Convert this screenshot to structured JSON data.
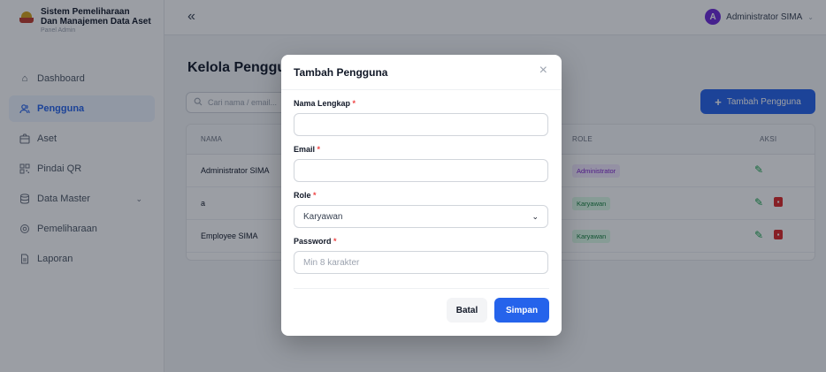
{
  "brand": {
    "title_line1": "Sistem Pemeliharaan",
    "title_line2": "Dan Manajemen Data Aset",
    "subtitle": "Panel Admin"
  },
  "sidebar": {
    "items": [
      {
        "label": "Dashboard",
        "icon": "home-icon"
      },
      {
        "label": "Pengguna",
        "icon": "users-icon",
        "active": true
      },
      {
        "label": "Aset",
        "icon": "box-icon"
      },
      {
        "label": "Pindai QR",
        "icon": "qr-icon"
      },
      {
        "label": "Data Master",
        "icon": "database-icon",
        "has_children": true
      },
      {
        "label": "Pemeliharaan",
        "icon": "gear-icon"
      },
      {
        "label": "Laporan",
        "icon": "document-icon"
      }
    ]
  },
  "header": {
    "collapse_icon": "«",
    "user_initial": "A",
    "user_name": "Administrator SIMA"
  },
  "main": {
    "title": "Kelola Pengguna",
    "search": {
      "placeholder": "Cari nama / email..."
    },
    "add_button": "Tambah Pengguna",
    "table": {
      "headers": {
        "name": "NAMA",
        "role": "ROLE",
        "actions": "AKSI"
      },
      "rows": [
        {
          "name": "Administrator SIMA",
          "role": "Administrator",
          "deletable": false
        },
        {
          "name": "a",
          "role": "Karyawan",
          "deletable": true
        },
        {
          "name": "Employee SIMA",
          "role": "Karyawan",
          "deletable": true
        }
      ]
    }
  },
  "modal": {
    "title": "Tambah Pengguna",
    "fields": {
      "name": {
        "label": "Nama Lengkap",
        "value": ""
      },
      "email": {
        "label": "Email",
        "value": ""
      },
      "role": {
        "label": "Role",
        "value": "Karyawan"
      },
      "password": {
        "label": "Password",
        "placeholder": "Min 8 karakter"
      }
    },
    "required_mark": "*",
    "cancel": "Batal",
    "save": "Simpan"
  },
  "colors": {
    "accent": "#2563eb",
    "active_nav_bg": "#eef4ff",
    "admin_badge": "#f3e8ff",
    "karyawan_badge": "#dcfce7",
    "danger": "#dc2626"
  }
}
